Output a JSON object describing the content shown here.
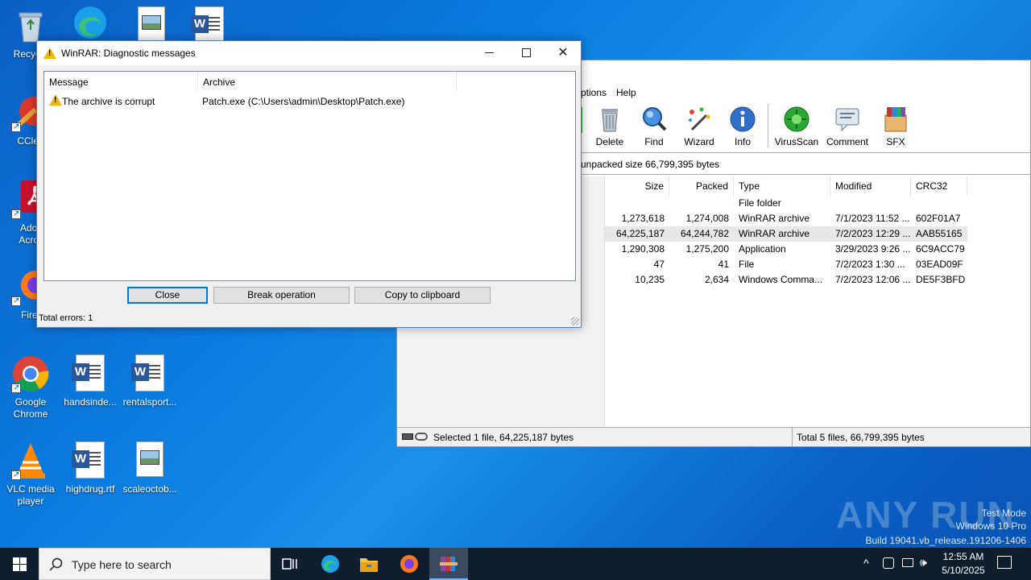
{
  "desktop": {
    "icons": [
      {
        "label": "Recycle"
      },
      {
        "label": "CClea"
      },
      {
        "label": "Adob Acrob"
      },
      {
        "label": "Firef"
      },
      {
        "label": "Google Chrome"
      },
      {
        "label": "handsinde..."
      },
      {
        "label": "rentalsport..."
      },
      {
        "label": "VLC media player"
      },
      {
        "label": "highdrug.rtf"
      },
      {
        "label": "scaleoctob..."
      }
    ]
  },
  "winrar": {
    "menu": {
      "options": "ptions",
      "help": "Help"
    },
    "toolbar": [
      {
        "label": "Delete",
        "icon": "trash-icon"
      },
      {
        "label": "Find",
        "icon": "magnifier-icon"
      },
      {
        "label": "Wizard",
        "icon": "wand-icon"
      },
      {
        "label": "Info",
        "icon": "info-icon"
      },
      {
        "label": "VirusScan",
        "icon": "virus-icon"
      },
      {
        "label": "Comment",
        "icon": "comment-icon"
      },
      {
        "label": "SFX",
        "icon": "sfx-icon"
      }
    ],
    "address_text": "unpacked size 66,799,395 bytes",
    "columns": [
      "Size",
      "Packed",
      "Type",
      "Modified",
      "CRC32"
    ],
    "rows": [
      {
        "size": "",
        "packed": "",
        "type": "File folder",
        "modified": "",
        "crc": ""
      },
      {
        "size": "1,273,618",
        "packed": "1,274,008",
        "type": "WinRAR archive",
        "modified": "7/1/2023 11:52 ...",
        "crc": "602F01A7"
      },
      {
        "size": "64,225,187",
        "packed": "64,244,782",
        "type": "WinRAR archive",
        "modified": "7/2/2023 12:29 ...",
        "crc": "AAB55165"
      },
      {
        "size": "1,290,308",
        "packed": "1,275,200",
        "type": "Application",
        "modified": "3/29/2023 9:26 ...",
        "crc": "6C9ACC79"
      },
      {
        "size": "47",
        "packed": "41",
        "type": "File",
        "modified": "7/2/2023 1:30 ...",
        "crc": "03EAD09F"
      },
      {
        "size": "10,235",
        "packed": "2,634",
        "type": "Windows Comma...",
        "modified": "7/2/2023 12:06 ...",
        "crc": "DE5F3BFD"
      }
    ],
    "status_left": "Selected 1 file, 64,225,187 bytes",
    "status_right": "Total 5 files, 66,799,395 bytes"
  },
  "dialog": {
    "title": "WinRAR: Diagnostic messages",
    "columns": {
      "message": "Message",
      "archive": "Archive"
    },
    "rows": [
      {
        "message": "The archive is corrupt",
        "archive": "Patch.exe (C:\\Users\\admin\\Desktop\\Patch.exe)"
      }
    ],
    "buttons": {
      "close": "Close",
      "break": "Break operation",
      "copy": "Copy to clipboard"
    },
    "status": "Total errors: 1"
  },
  "watermark": {
    "brand": "ANY RUN",
    "line1": "Test Mode",
    "line2": "Windows 10 Pro",
    "line3": "Build 19041.vb_release.191206-1406"
  },
  "taskbar": {
    "search_placeholder": "Type here to search",
    "time": "12:55 AM",
    "date": "5/10/2025"
  },
  "colors": {
    "accent": "#0078d7",
    "taskbar": "#101d2e",
    "warning": "#f2b70f"
  }
}
